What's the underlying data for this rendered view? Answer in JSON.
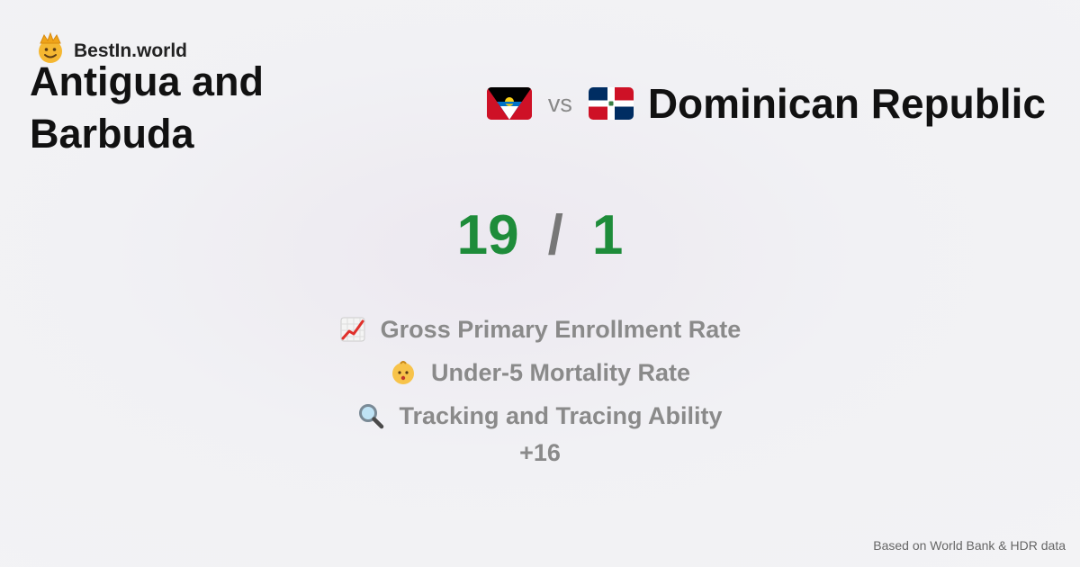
{
  "brand": {
    "name": "BestIn.world",
    "icon": "crown-face-icon"
  },
  "comparison": {
    "left_country": "Antigua and Barbuda",
    "left_flag": "antigua-flag-icon",
    "vs_label": "vs",
    "right_country": "Dominican Republic",
    "right_flag": "dominican-republic-flag-icon"
  },
  "score": {
    "left": "19",
    "separator": "/",
    "right": "1",
    "color": "#1e8c3a"
  },
  "metrics": [
    {
      "icon": "chart-increasing-icon",
      "label": "Gross Primary Enrollment Rate"
    },
    {
      "icon": "baby-face-icon",
      "label": "Under-5 Mortality Rate"
    },
    {
      "icon": "magnifying-glass-icon",
      "label": "Tracking and Tracing Ability"
    }
  ],
  "more_label": "+16",
  "footer": "Based on World Bank & HDR data"
}
